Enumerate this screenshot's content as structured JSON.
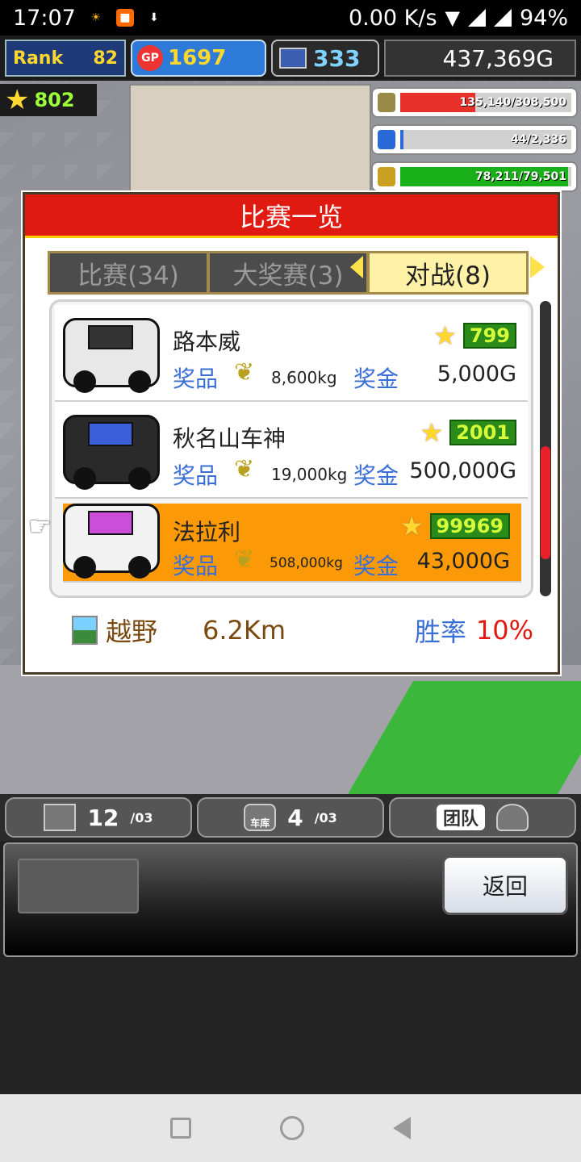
{
  "status_bar": {
    "time": "17:07",
    "net_speed": "0.00 K/s",
    "battery": "94%"
  },
  "hud": {
    "rank_label": "Rank",
    "rank_value": "82",
    "gp_badge": "GP",
    "gp_value": "1697",
    "pc_value": "333",
    "money": "437,369G",
    "stars": "802"
  },
  "resources": [
    {
      "icon": "coins-icon",
      "text": "135,140/308,500",
      "color": "#e8302a",
      "fill": 0.44
    },
    {
      "icon": "fuel-icon",
      "text": "44/2,336",
      "color": "#2a6ad8",
      "fill": 0.02
    },
    {
      "icon": "wheat-icon",
      "text": "78,211/79,501",
      "color": "#19b019",
      "fill": 0.98
    }
  ],
  "dialog": {
    "title": "比赛一览",
    "tabs": [
      {
        "label": "比赛(34)",
        "active": false
      },
      {
        "label": "大奖赛(3)",
        "active": false
      },
      {
        "label": "对战(8)",
        "active": true
      }
    ],
    "races": [
      {
        "name": "路本威",
        "score": "799",
        "prize_label": "奖品",
        "weight": "8,600kg",
        "bonus_label": "奖金",
        "bonus": "5,000G",
        "selected": false,
        "car_color": "#e8e8e8"
      },
      {
        "name": "秋名山车神",
        "score": "2001",
        "prize_label": "奖品",
        "weight": "19,000kg",
        "bonus_label": "奖金",
        "bonus": "500,000G",
        "selected": false,
        "car_color": "#2a2a2a"
      },
      {
        "name": "法拉利",
        "score": "99969",
        "prize_label": "奖品",
        "weight": "508,000kg",
        "bonus_label": "奖金",
        "bonus": "43,000G",
        "selected": true,
        "car_color": "#f2f2f2"
      }
    ],
    "footer": {
      "terrain": "越野",
      "distance": "6.2Km",
      "win_rate_label": "胜率",
      "win_rate": "10%"
    }
  },
  "toolbar": {
    "slot1_count": "12",
    "slot1_total": "/03",
    "garage_label": "车库",
    "slot2_count": "4",
    "slot2_total": "/03",
    "team_label": "团队"
  },
  "back_label": "返回"
}
